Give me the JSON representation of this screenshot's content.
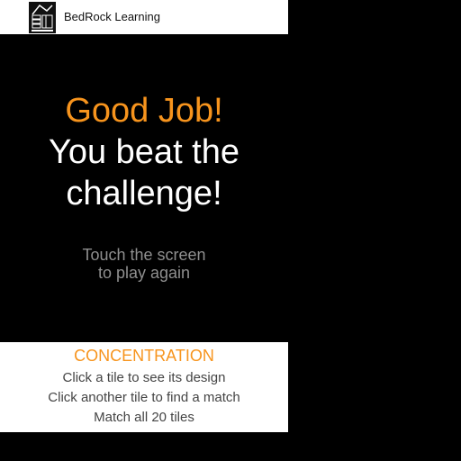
{
  "header": {
    "logo_icon": "bedrock-learning-logo-icon",
    "brand_name": "BedRock Learning"
  },
  "win_screen": {
    "headline": "Good Job!",
    "message_lines": [
      "You beat the",
      "challenge!"
    ],
    "prompt_lines": [
      "Touch the screen",
      "to play again"
    ]
  },
  "instructions": {
    "title": "CONCENTRATION",
    "rules": [
      "Click a tile to see its design",
      "Click another tile to find a match",
      "Match all 20 tiles"
    ]
  },
  "colors": {
    "accent": "#f7941d",
    "background": "#000000",
    "panel": "#ffffff",
    "muted_text": "#8f8f8f",
    "body_text": "#444444"
  }
}
